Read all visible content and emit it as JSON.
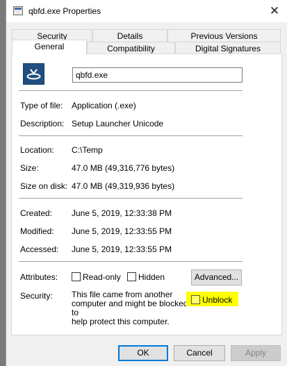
{
  "window": {
    "title": "qbfd.exe Properties"
  },
  "tabs": {
    "row1": [
      "Security",
      "Details",
      "Previous Versions"
    ],
    "row2": [
      "General",
      "Compatibility",
      "Digital Signatures"
    ],
    "active": "General"
  },
  "general": {
    "file_name": "qbfd.exe",
    "type_label": "Type of file:",
    "type_value": "Application (.exe)",
    "description_label": "Description:",
    "description_value": "Setup Launcher Unicode",
    "location_label": "Location:",
    "location_value": "C:\\Temp",
    "size_label": "Size:",
    "size_value": "47.0 MB (49,316,776 bytes)",
    "size_on_disk_label": "Size on disk:",
    "size_on_disk_value": "47.0 MB (49,319,936 bytes)",
    "created_label": "Created:",
    "created_value": "June 5, 2019, 12:33:38 PM",
    "modified_label": "Modified:",
    "modified_value": "June 5, 2019, 12:33:55 PM",
    "accessed_label": "Accessed:",
    "accessed_value": "June 5, 2019, 12:33:55 PM",
    "attributes_label": "Attributes:",
    "readonly_label": "Read-only",
    "hidden_label": "Hidden",
    "advanced_label": "Advanced...",
    "security_label": "Security:",
    "security_text_1": "This file came from another",
    "security_text_2": "computer and might be blocked to",
    "security_text_3": "help protect this computer.",
    "unblock_label": "Unblock"
  },
  "buttons": {
    "ok": "OK",
    "cancel": "Cancel",
    "apply": "Apply"
  },
  "colors": {
    "highlight": "#ffff00",
    "accent": "#0078d7",
    "icon": "#1f4f80"
  },
  "icons": {
    "title": "application-icon",
    "file": "installer-app-icon",
    "close": "close-icon"
  }
}
